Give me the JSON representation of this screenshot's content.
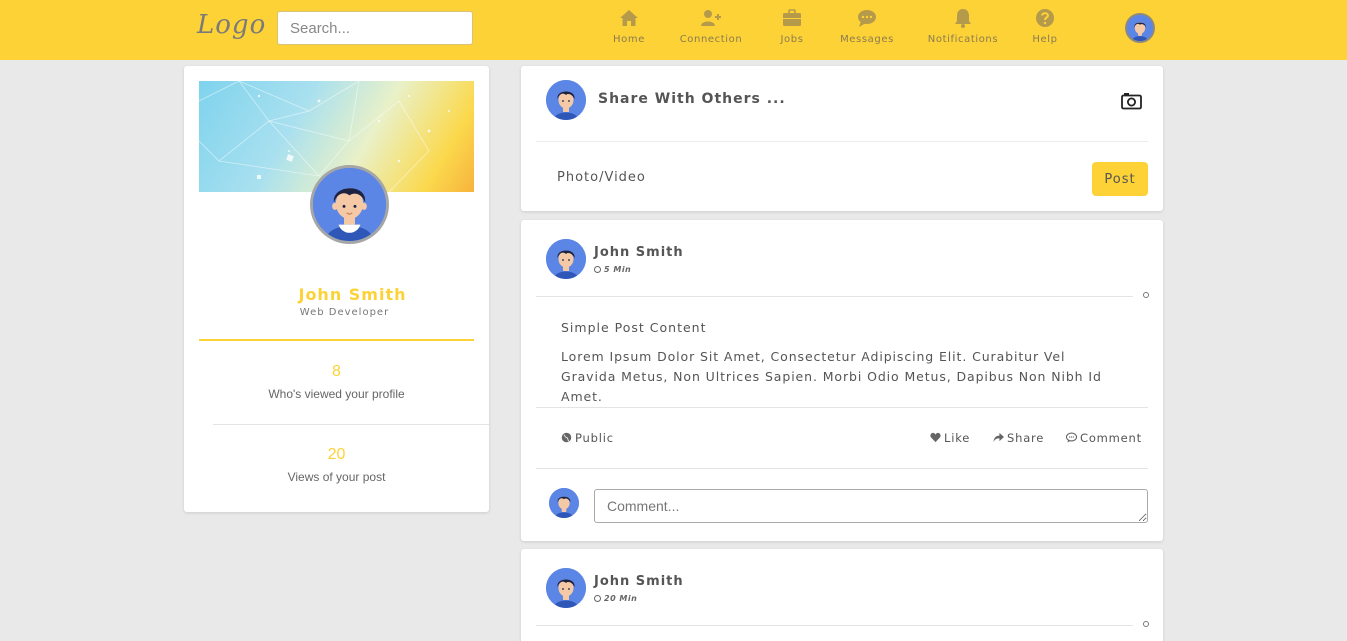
{
  "topbar": {
    "logo": "Logo",
    "search_placeholder": "Search...",
    "nav": [
      {
        "label": "Home",
        "icon": "home-icon"
      },
      {
        "label": "Connection",
        "icon": "user-plus-icon"
      },
      {
        "label": "Jobs",
        "icon": "briefcase-icon"
      },
      {
        "label": "Messages",
        "icon": "comment-icon"
      },
      {
        "label": "Notifications",
        "icon": "bell-icon"
      },
      {
        "label": "Help",
        "icon": "question-icon"
      }
    ]
  },
  "profile": {
    "name": "John Smith",
    "title": "Web Developer",
    "stats": [
      {
        "value": "8",
        "label": "Who's viewed your profile"
      },
      {
        "value": "20",
        "label": "Views of your post"
      }
    ]
  },
  "share": {
    "title": "Share With Others ...",
    "photo_video": "Photo/Video",
    "post_button": "Post"
  },
  "posts": [
    {
      "author": "John Smith",
      "time": "5 Min",
      "heading": "Simple Post Content",
      "body": "Lorem Ipsum Dolor Sit Amet, Consectetur Adipiscing Elit. Curabitur Vel Gravida Metus, Non Ultrices Sapien. Morbi Odio Metus, Dapibus Non Nibh Id Amet.",
      "visibility": "Public",
      "actions": {
        "like": "Like",
        "share": "Share",
        "comment": "Comment"
      },
      "comment_placeholder": "Comment..."
    },
    {
      "author": "John Smith",
      "time": "20 Min"
    }
  ],
  "colors": {
    "accent": "#fdd236",
    "background": "#e9e9e9",
    "avatar_bg": "#5b86e5"
  }
}
